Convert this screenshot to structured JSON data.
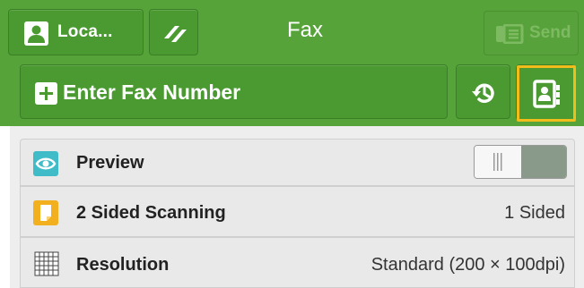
{
  "header": {
    "user_label": "Loca...",
    "title": "Fax",
    "send_label": "Send",
    "fax_number_label": "Enter Fax Number"
  },
  "rows": [
    {
      "label": "Preview",
      "value": "",
      "toggle_on": false
    },
    {
      "label": "2 Sided Scanning",
      "value": "1 Sided"
    },
    {
      "label": "Resolution",
      "value": "Standard (200 × 100dpi)"
    }
  ],
  "colors": {
    "header_green": "#56a33a",
    "highlight_yellow": "#f2bd1a",
    "preview_icon": "#3fbcc8",
    "scan_icon": "#f2b01e"
  },
  "icons": {
    "user": "user-icon",
    "clear": "clear-icon",
    "send": "fax-send-icon",
    "add": "plus-icon",
    "history": "history-icon",
    "address_book": "address-book-icon",
    "preview": "eye-icon",
    "sided": "page-icon",
    "resolution": "grid-icon"
  }
}
